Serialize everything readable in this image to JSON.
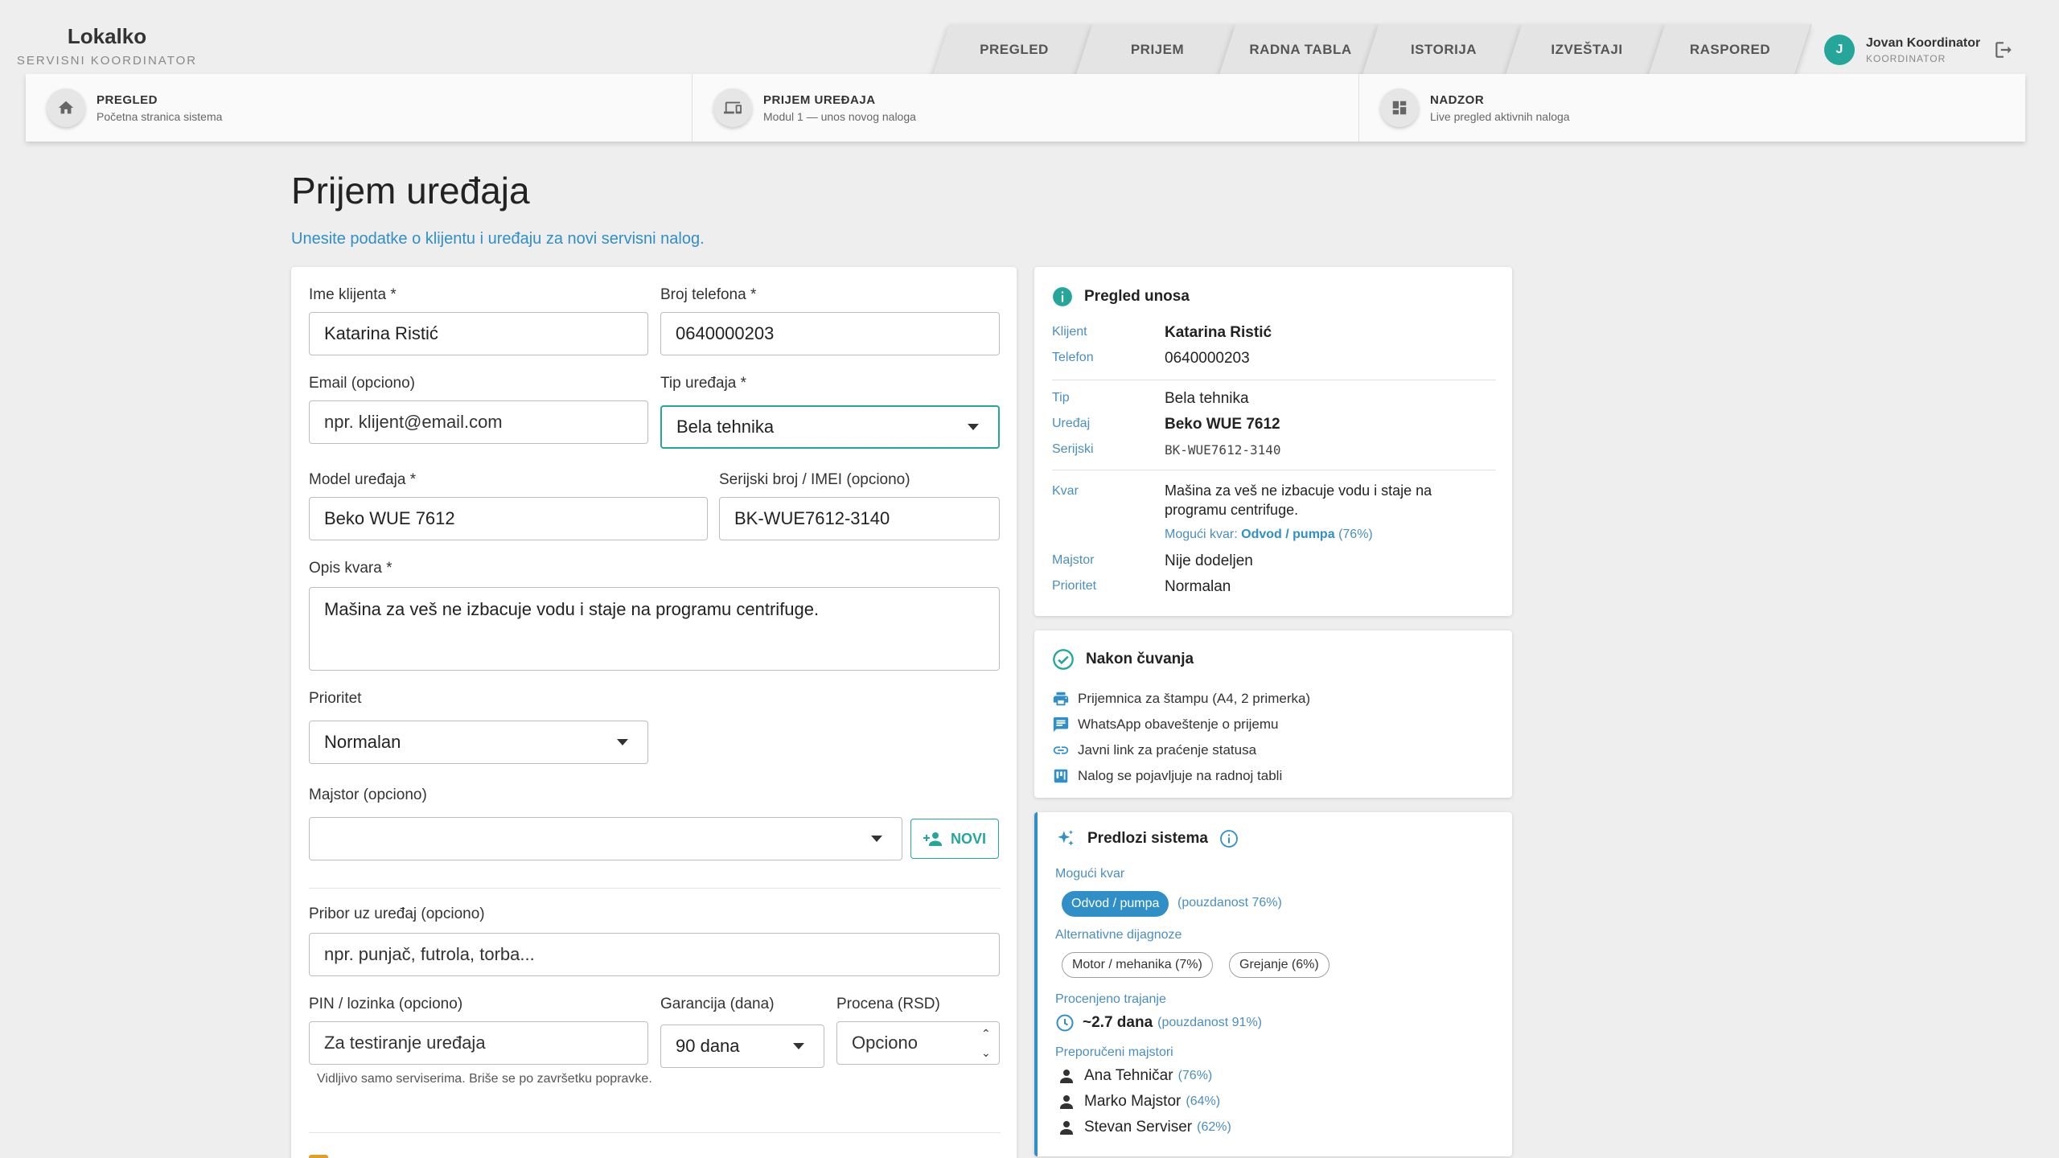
{
  "brand": {
    "name": "Lokalko",
    "subtitle": "SERVISNI KOORDINATOR"
  },
  "nav_tabs": [
    "PREGLED",
    "PRIJEM",
    "RADNA TABLA",
    "ISTORIJA",
    "IZVEŠTAJI",
    "RASPORED"
  ],
  "user": {
    "initial": "J",
    "name": "Jovan Koordinator",
    "role": "KOORDINATOR"
  },
  "quick_nav": [
    {
      "title": "PREGLED",
      "subtitle": "Početna stranica sistema",
      "icon": "home-icon"
    },
    {
      "title": "PRIJEM UREĐAJA",
      "subtitle": "Modul 1 — unos novog naloga",
      "icon": "devices-icon"
    },
    {
      "title": "NADZOR",
      "subtitle": "Live pregled aktivnih naloga",
      "icon": "dashboard-icon"
    }
  ],
  "page": {
    "title": "Prijem uređaja",
    "subtitle": "Unesite podatke o klijentu i uređaju za novi servisni nalog."
  },
  "form": {
    "client_name": {
      "label": "Ime klijenta *",
      "value": "Katarina Ristić"
    },
    "phone": {
      "label": "Broj telefona *",
      "value": "0640000203"
    },
    "email": {
      "label": "Email (opciono)",
      "placeholder": "npr. klijent@email.com"
    },
    "device_type": {
      "label": "Tip uređaja *",
      "value": "Bela tehnika"
    },
    "model": {
      "label": "Model uređaja *",
      "value": "Beko WUE 7612"
    },
    "serial": {
      "label": "Serijski broj / IMEI (opciono)",
      "value": "BK-WUE7612-3140"
    },
    "fault": {
      "label": "Opis kvara *",
      "value": "Mašina za veš ne izbacuje vodu i staje na programu centrifuge."
    },
    "priority": {
      "label": "Prioritet",
      "value": "Normalan"
    },
    "technician": {
      "label": "Majstor (opciono)",
      "value": "",
      "new_button": "NOVI"
    },
    "accessories": {
      "label": "Pribor uz uređaj (opciono)",
      "placeholder": "npr. punjač, futrola, torba..."
    },
    "pin": {
      "label": "PIN / lozinka (opciono)",
      "placeholder": "Za testiranje uređaja",
      "hint": "Vidljivo samo serviserima. Briše se po završetku popravke."
    },
    "warranty": {
      "label": "Garancija (dana)",
      "value": "90 dana"
    },
    "estimate": {
      "label": "Procena (RSD)",
      "placeholder": "Opciono"
    }
  },
  "review": {
    "title": "Pregled unosa",
    "rows": {
      "client": {
        "key": "Klijent",
        "value": "Katarina Ristić"
      },
      "phone": {
        "key": "Telefon",
        "value": "0640000203"
      },
      "type": {
        "key": "Tip",
        "value": "Bela tehnika"
      },
      "device": {
        "key": "Uređaj",
        "value": "Beko WUE 7612"
      },
      "serial": {
        "key": "Serijski",
        "value": "BK-WUE7612-3140"
      },
      "fault": {
        "key": "Kvar",
        "value": "Mašina za veš ne izbacuje vodu i staje na programu centrifuge."
      },
      "technician": {
        "key": "Majstor",
        "value": "Nije dodeljen"
      },
      "priority": {
        "key": "Prioritet",
        "value": "Normalan"
      }
    },
    "possible_fault": {
      "prefix": "Mogući kvar:",
      "name": "Odvod / pumpa",
      "pct": "(76%)"
    }
  },
  "after_save": {
    "title": "Nakon čuvanja",
    "items": [
      {
        "text": "Prijemnica za štampu (A4, 2 primerka)",
        "icon": "print-icon"
      },
      {
        "text": "WhatsApp obaveštenje o prijemu",
        "icon": "chat-icon"
      },
      {
        "text": "Javni link za praćenje statusa",
        "icon": "link-icon"
      },
      {
        "text": "Nalog se pojavljuje na radnoj tabli",
        "icon": "board-icon"
      }
    ]
  },
  "suggestions": {
    "title": "Predlozi sistema",
    "possible_fault_label": "Mogući kvar",
    "possible_fault": "Odvod / pumpa",
    "possible_fault_conf": "(pouzdanost 76%)",
    "alt_label": "Alternativne dijagnoze",
    "alternatives": [
      "Motor / mehanika (7%)",
      "Grejanje (6%)"
    ],
    "duration_label": "Procenjeno trajanje",
    "duration": "~2.7 dana",
    "duration_conf": "(pouzdanost 91%)",
    "techs_label": "Preporučeni majstori",
    "techs": [
      {
        "name": "Ana Tehničar",
        "pct": "(76%)"
      },
      {
        "name": "Marko Majstor",
        "pct": "(64%)"
      },
      {
        "name": "Stevan Serviser",
        "pct": "(62%)"
      }
    ]
  },
  "colors": {
    "accent": "#26a69a",
    "link": "#2f8fc6",
    "warning": "#e0a028"
  }
}
